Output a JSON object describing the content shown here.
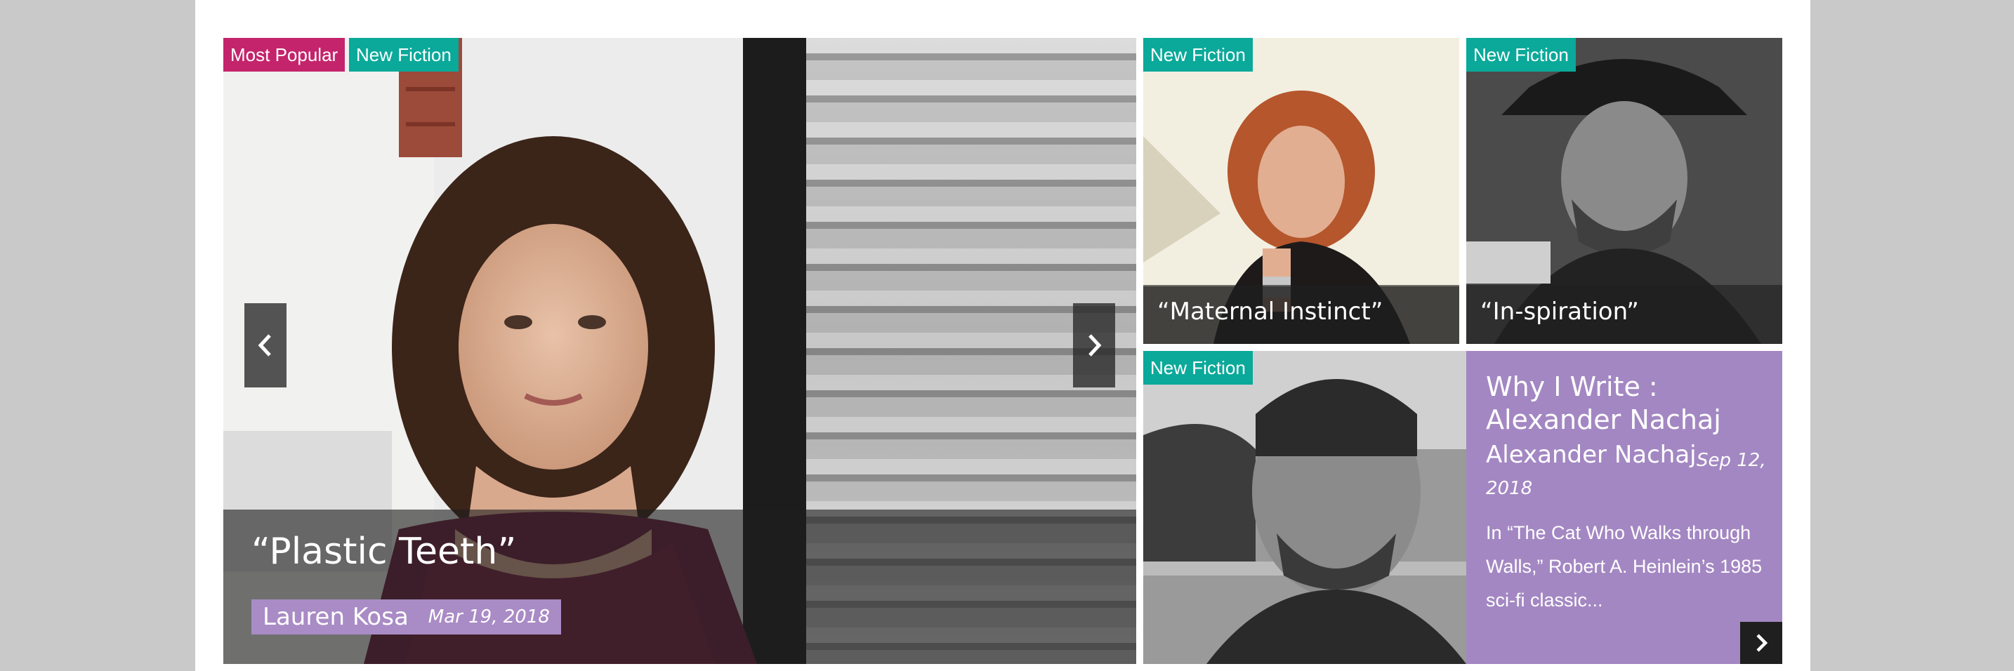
{
  "featured": {
    "tags": [
      "Most Popular",
      "New Fiction"
    ],
    "title": "“Plastic Teeth”",
    "author": "Lauren Kosa",
    "date": "Mar 19, 2018",
    "prev_icon": "chevron-left-icon",
    "next_icon": "chevron-right-icon"
  },
  "tiles": [
    {
      "tag": "New Fiction",
      "title": "“Maternal Instinct”"
    },
    {
      "tag": "New Fiction",
      "title": "“In-spiration”"
    },
    {
      "tag": "New Fiction",
      "title": ""
    }
  ],
  "why_write": {
    "title": "Why I Write : Alexander Nachaj",
    "author": "Alexander Nachaj",
    "date": "Sep 12, 2018",
    "excerpt": "In “The Cat Who Walks through Walls,” Robert A. Heinlein’s 1985 sci-fi classic...",
    "more_icon": "chevron-right-icon"
  },
  "colors": {
    "most_popular": "#c4246b",
    "new_fiction": "#0aa99a",
    "accent_purple": "#a387c2",
    "byline_purple": "#a98bc5"
  }
}
